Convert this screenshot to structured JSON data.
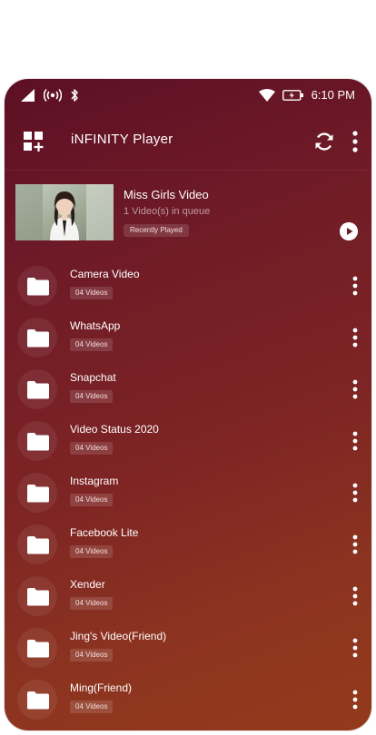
{
  "status_bar": {
    "time": "6:10 PM"
  },
  "app_bar": {
    "title": "iNFINITY Player"
  },
  "recent": {
    "title": "Miss Girls Video",
    "subtitle": "1 Video(s) in queue",
    "badge": "Recently Played"
  },
  "folders": [
    {
      "name": "Camera Video",
      "count": "04 Videos"
    },
    {
      "name": "WhatsApp",
      "count": "04 Videos"
    },
    {
      "name": "Snapchat",
      "count": "04 Videos"
    },
    {
      "name": "Video Status 2020",
      "count": "04 Videos"
    },
    {
      "name": "Instagram",
      "count": "04 Videos"
    },
    {
      "name": "Facebook Lite",
      "count": "04 Videos"
    },
    {
      "name": "Xender",
      "count": "04 Videos"
    },
    {
      "name": "Jing's Video(Friend)",
      "count": "04 Videos"
    },
    {
      "name": "Ming(Friend)",
      "count": "04 Videos"
    }
  ],
  "icons": {
    "app_icon": "grid-add-icon",
    "refresh": "refresh-icon",
    "more": "more-vertical-icon",
    "folder": "folder-icon",
    "play": "play-icon"
  }
}
